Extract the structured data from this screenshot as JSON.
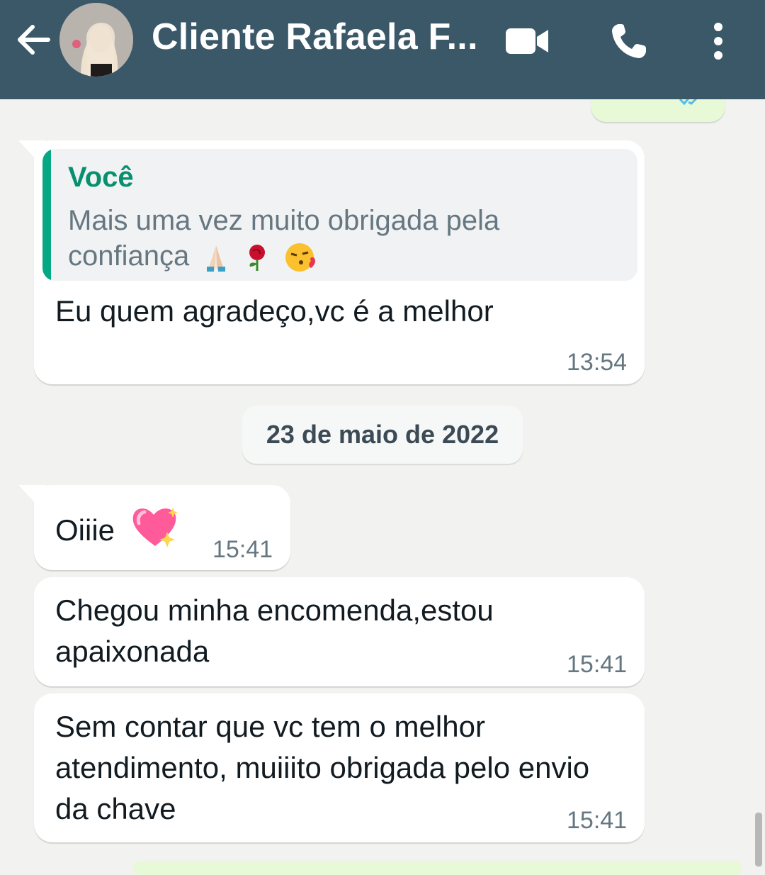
{
  "header": {
    "title": "Cliente Rafaela F...",
    "bg_color": "#3b5869"
  },
  "icons": {
    "back": "arrow-left-icon",
    "video": "video-camera-icon",
    "call": "phone-icon",
    "menu": "more-vertical-icon"
  },
  "messages": [
    {
      "quote_author": "Você",
      "quote_text": "Mais uma vez muito obrigada pela confiança",
      "text": "Eu quem agradeço,vc é a melhor",
      "time": "13:54"
    },
    {
      "text": "Oiiie",
      "time": "15:41"
    },
    {
      "text": "Chegou minha encomenda,estou apaixonada",
      "time": "15:41"
    },
    {
      "text": "Sem contar que vc tem o melhor atendimento, muiiito obrigada pelo envio da chave",
      "time": "15:41"
    }
  ],
  "date_separator": "23 de maio de 2022",
  "colors": {
    "chat_bg": "#f2f2f0",
    "incoming_bubble": "#ffffff",
    "outgoing_bubble": "#e7f9d6",
    "quote_accent": "#06a884",
    "time_text": "#667781"
  }
}
